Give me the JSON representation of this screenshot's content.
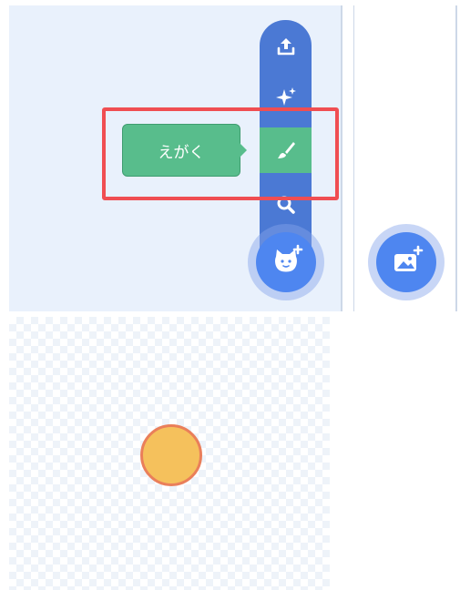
{
  "menu": {
    "items": [
      {
        "name": "upload",
        "icon": "upload-icon"
      },
      {
        "name": "surprise",
        "icon": "sparkle-icon"
      },
      {
        "name": "paint",
        "icon": "paintbrush-icon"
      },
      {
        "name": "search",
        "icon": "search-icon"
      }
    ]
  },
  "tooltip": {
    "label": "えがく"
  },
  "buttons": {
    "choose_sprite_icon": "cat-plus-icon",
    "choose_backdrop_icon": "image-plus-icon"
  },
  "colors": {
    "menu_blue": "#4b79d4",
    "paint_green": "#58bd8c",
    "highlight_red": "#f04e52",
    "sprite_fill": "#f5c15c",
    "sprite_outline": "#ea7f5a"
  }
}
